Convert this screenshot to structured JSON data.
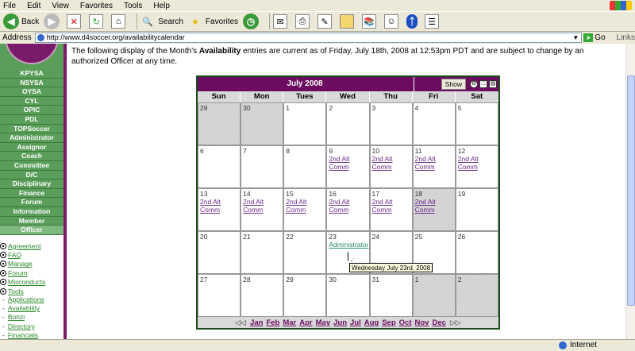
{
  "menubar": {
    "items": [
      "File",
      "Edit",
      "View",
      "Favorites",
      "Tools",
      "Help"
    ]
  },
  "toolbar": {
    "back": "Back",
    "search": "Search",
    "favorites": "Favorites"
  },
  "address": {
    "label": "Address",
    "url": "http://www.d4soccer.org/availabilitycalendar",
    "go": "Go",
    "links": "Links"
  },
  "sidebar": {
    "nav": [
      "KPYSA",
      "NSYSA",
      "OYSA",
      "CYL",
      "OPIC",
      "PDL",
      "TOPSoccer",
      "Administrator",
      "Assignor",
      "Coach",
      "Committee",
      "D/C",
      "Disciplinary",
      "Finance",
      "Forum",
      "Information",
      "Member",
      "Officer"
    ],
    "links": [
      "Agreement",
      "FAQ",
      "Manage",
      "Forum",
      "Misconducts",
      "Tools"
    ],
    "sublinks": [
      "Applications",
      "Availability",
      "Bonzi",
      "Directory",
      "Financials"
    ]
  },
  "intro": {
    "part1": "The following display of the Month's ",
    "bold": "Availability",
    "part2": " entries are current as of Friday, July 18th, 2008 at 12:53pm PDT and are subject to change by an authorized Officer at any time."
  },
  "calendar": {
    "title": "July 2008",
    "show_label": "Show",
    "days": [
      "Sun",
      "Mon",
      "Tues",
      "Wed",
      "Thu",
      "Fri",
      "Sat"
    ],
    "weeks": [
      [
        {
          "d": "29",
          "dim": true
        },
        {
          "d": "30",
          "dim": true
        },
        {
          "d": "1"
        },
        {
          "d": "2"
        },
        {
          "d": "3"
        },
        {
          "d": "4"
        },
        {
          "d": "5"
        }
      ],
      [
        {
          "d": "6"
        },
        {
          "d": "7"
        },
        {
          "d": "8"
        },
        {
          "d": "9",
          "e": [
            "2nd Alt",
            "Comm"
          ]
        },
        {
          "d": "10",
          "e": [
            "2nd Alt",
            "Comm"
          ]
        },
        {
          "d": "11",
          "e": [
            "2nd Alt",
            "Comm"
          ]
        },
        {
          "d": "12",
          "e": [
            "2nd Alt",
            "Comm"
          ]
        }
      ],
      [
        {
          "d": "13",
          "e": [
            "2nd Alt",
            "Comm"
          ]
        },
        {
          "d": "14",
          "e": [
            "2nd Alt",
            "Comm"
          ]
        },
        {
          "d": "15",
          "e": [
            "2nd Alt",
            "Comm"
          ]
        },
        {
          "d": "16",
          "e": [
            "2nd Alt",
            "Comm"
          ]
        },
        {
          "d": "17",
          "e": [
            "2nd Alt",
            "Comm"
          ]
        },
        {
          "d": "18",
          "dim": true,
          "e": [
            "2nd Alt",
            "Comm"
          ]
        },
        {
          "d": "19"
        }
      ],
      [
        {
          "d": "20"
        },
        {
          "d": "21"
        },
        {
          "d": "22"
        },
        {
          "d": "23",
          "admin": "Administrator"
        },
        {
          "d": "24"
        },
        {
          "d": "25"
        },
        {
          "d": "26"
        }
      ],
      [
        {
          "d": "27"
        },
        {
          "d": "28"
        },
        {
          "d": "29"
        },
        {
          "d": "30"
        },
        {
          "d": "31"
        },
        {
          "d": "1",
          "dim": true
        },
        {
          "d": "2",
          "dim": true
        }
      ]
    ],
    "months": [
      "Jan",
      "Feb",
      "Mar",
      "Apr",
      "May",
      "Jun",
      "Jul",
      "Aug",
      "Sep",
      "Oct",
      "Nov",
      "Dec"
    ],
    "tooltip": "Wednesday July 23rd, 2008"
  },
  "status": {
    "zone": "Internet"
  }
}
